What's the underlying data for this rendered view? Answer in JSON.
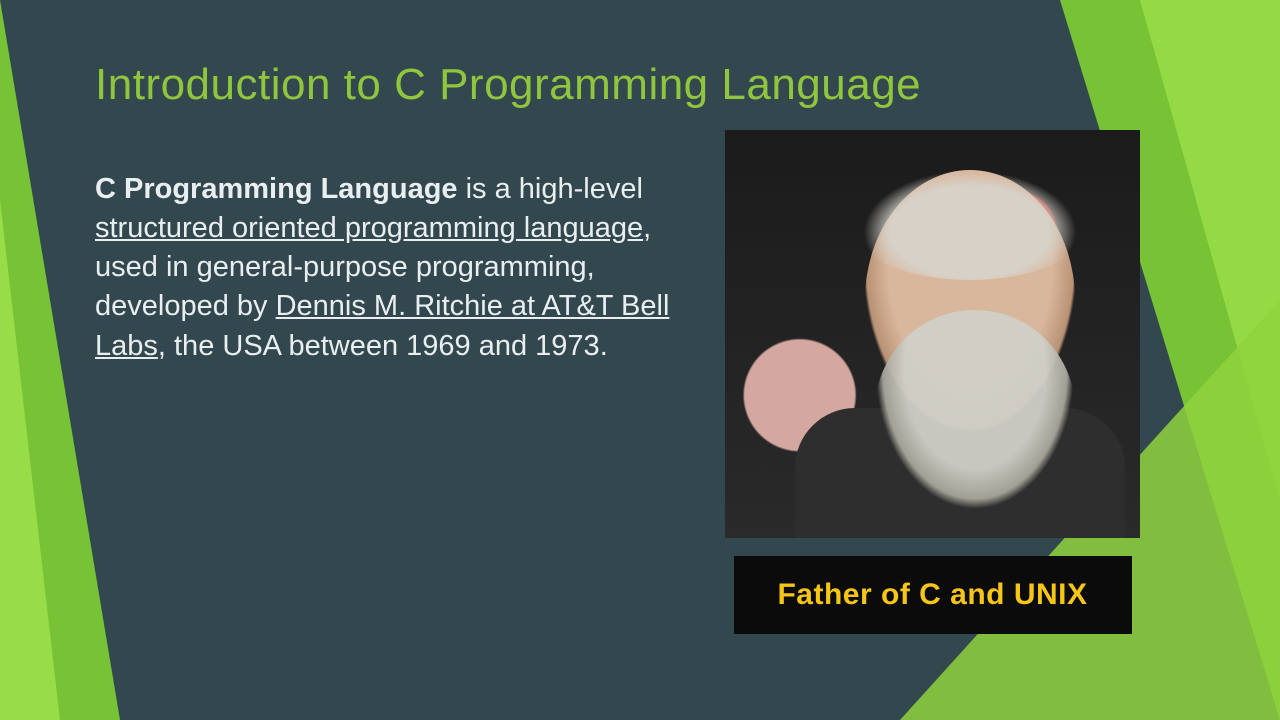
{
  "title": "Introduction to C Programming Language",
  "body": {
    "bold_lead": "C Programming Language",
    "seg1": " is a high-level ",
    "ul1": "structured oriented programming language",
    "seg2": ", used in general-purpose programming, developed by ",
    "ul2": "Dennis M. Ritchie at AT&T Bell Labs",
    "seg3": ", the USA between 1969 and 1973."
  },
  "caption": "Father of C and UNIX",
  "portrait_subject": "Dennis M. Ritchie"
}
